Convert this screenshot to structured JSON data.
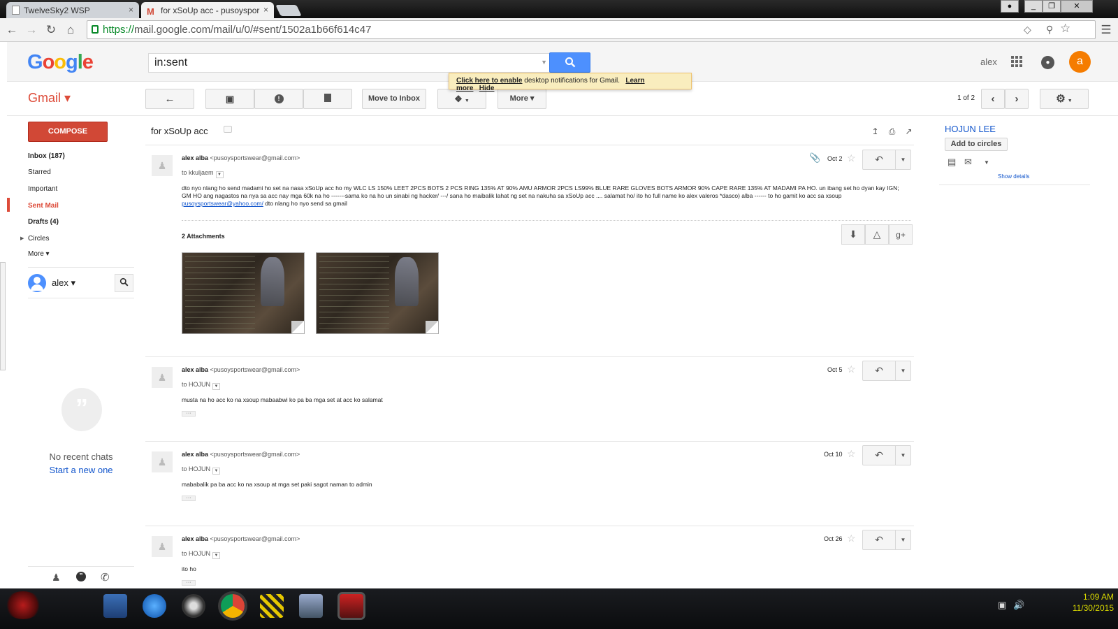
{
  "browser": {
    "tabs": [
      {
        "title": "TwelveSky2 WSP",
        "close": "×"
      },
      {
        "title": "for xSoUp acc - pusoyspor",
        "close": "×"
      }
    ],
    "url_https": "https://",
    "url_rest": "mail.google.com/mail/u/0/#sent/1502a1b66f614c47",
    "window_buttons": [
      "_",
      "❐",
      "✕"
    ]
  },
  "header": {
    "logo_letters": [
      "G",
      "o",
      "o",
      "g",
      "l",
      "e"
    ],
    "logo_colors": [
      "#4285f4",
      "#ea4335",
      "#fbbc05",
      "#4285f4",
      "#34a853",
      "#ea4335"
    ],
    "search_value": "in:sent",
    "user_name": "alex",
    "avatar_letter": "a"
  },
  "notification": {
    "link": "Click here to enable",
    "text": " desktop notifications for Gmail.",
    "learn_more": "Learn more",
    "hide": "Hide"
  },
  "gmail_bar": {
    "label": "Gmail ▾",
    "move_to_inbox": "Move to Inbox",
    "more": "More ▾",
    "pager": "1 of 2"
  },
  "sidebar": {
    "compose": "COMPOSE",
    "items": [
      {
        "label": "Inbox (187)",
        "style": "b"
      },
      {
        "label": "Starred",
        "style": ""
      },
      {
        "label": "Important",
        "style": ""
      },
      {
        "label": "Sent Mail",
        "style": "sel"
      },
      {
        "label": "Drafts (4)",
        "style": "b"
      },
      {
        "label": "Circles",
        "style": ""
      },
      {
        "label": "More ▾",
        "style": ""
      }
    ],
    "chat_user": "alex ▾",
    "no_chats": "No recent chats",
    "start_new": "Start a new one"
  },
  "thread": {
    "subject": "for xSoUp acc",
    "messages": [
      {
        "from_name": "alex alba",
        "from_email": "<pusoysportswear@gmail.com>",
        "to": "to kkuljaem",
        "date": "Oct 2",
        "body": "dto nyo nlang ho send madami ho set na nasa xSoUp acc ho my WLC LS 150% LEET 2PCS BOTS 2 PCS RING 135% AT 90% AMU ARMOR 2PCS LS99%  BLUE RARE GLOVES BOTS ARMOR 90% CAPE RARE 135% AT MADAMI PA  HO. un ibang set ho dyan kay IGN; GM HO  ang nagastos na nya sa acc nay mga 60k na ho -------sama ko na ho un sinabi ng hacker/ ---/ sana ho maibalik lahat ng set na nakuha sa xSoUp acc .... salamat ho/  ito ho full name ko alex valeros *dasco) alba ------ to ho gamit ko acc sa xsoup ",
        "link": "pusoysportswear@yahoo.com/",
        "body_end": "  dto nlang ho nyo send sa gmail",
        "attachments_label": "2 Attachments"
      },
      {
        "from_name": "alex alba",
        "from_email": "<pusoysportswear@gmail.com>",
        "to": "to HOJUN",
        "date": "Oct 5",
        "body": "musta na ho acc ko na xsoup mabaabwi ko pa ba mga set at acc ko salamat"
      },
      {
        "from_name": "alex alba",
        "from_email": "<pusoysportswear@gmail.com>",
        "to": "to HOJUN",
        "date": "Oct 10",
        "body": "mababalik pa ba acc ko na xsoup at mga set  paki sagot naman to admin"
      },
      {
        "from_name": "alex alba",
        "from_email": "<pusoysportswear@gmail.com>",
        "to": "to HOJUN",
        "date": "Oct 26",
        "body": "ito ho"
      }
    ]
  },
  "contact": {
    "name": "HOJUN LEE",
    "add_circles": "Add to circles",
    "show_details": "Show details"
  },
  "taskbar": {
    "time": "1:09 AM",
    "date": "11/30/2015"
  },
  "icons": {
    "reply": "reply-arrow-icon",
    "star": "star-icon",
    "paperclip": "paperclip-icon",
    "gear": "gear-icon"
  }
}
